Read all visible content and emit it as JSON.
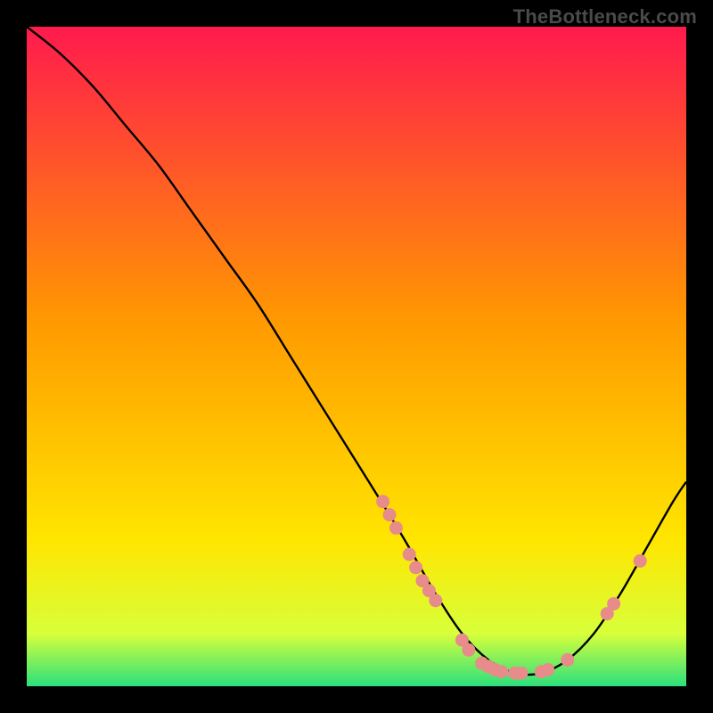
{
  "watermark": "TheBottleneck.com",
  "chart_data": {
    "type": "line",
    "title": "",
    "xlabel": "",
    "ylabel": "",
    "xlim": [
      0,
      100
    ],
    "ylim": [
      0,
      100
    ],
    "background_gradient": {
      "top": "#ff1a4d",
      "mid": "#ffe600",
      "bottom": "#2be07d"
    },
    "series": [
      {
        "name": "bottleneck-curve",
        "x": [
          0,
          5,
          10,
          15,
          20,
          25,
          30,
          35,
          40,
          45,
          50,
          55,
          58,
          62,
          66,
          70,
          74,
          78,
          82,
          86,
          90,
          94,
          98,
          100
        ],
        "y": [
          100,
          96,
          91,
          85,
          79,
          72,
          65,
          58,
          50,
          42,
          34,
          26,
          21,
          14,
          8,
          4,
          2,
          2,
          4,
          8,
          14,
          21,
          28,
          31
        ]
      }
    ],
    "scatter_points": {
      "name": "highlighted-points",
      "color": "#e78b8b",
      "points": [
        {
          "x": 54,
          "y": 28
        },
        {
          "x": 55,
          "y": 26
        },
        {
          "x": 56,
          "y": 24
        },
        {
          "x": 58,
          "y": 20
        },
        {
          "x": 59,
          "y": 18
        },
        {
          "x": 60,
          "y": 16
        },
        {
          "x": 61,
          "y": 14.5
        },
        {
          "x": 62,
          "y": 13
        },
        {
          "x": 66,
          "y": 7
        },
        {
          "x": 67,
          "y": 5.5
        },
        {
          "x": 69,
          "y": 3.5
        },
        {
          "x": 70,
          "y": 3
        },
        {
          "x": 71,
          "y": 2.5
        },
        {
          "x": 72,
          "y": 2.2
        },
        {
          "x": 74,
          "y": 2
        },
        {
          "x": 75,
          "y": 2
        },
        {
          "x": 78,
          "y": 2.2
        },
        {
          "x": 79,
          "y": 2.5
        },
        {
          "x": 82,
          "y": 4
        },
        {
          "x": 88,
          "y": 11
        },
        {
          "x": 89,
          "y": 12.5
        },
        {
          "x": 93,
          "y": 19
        }
      ]
    }
  }
}
